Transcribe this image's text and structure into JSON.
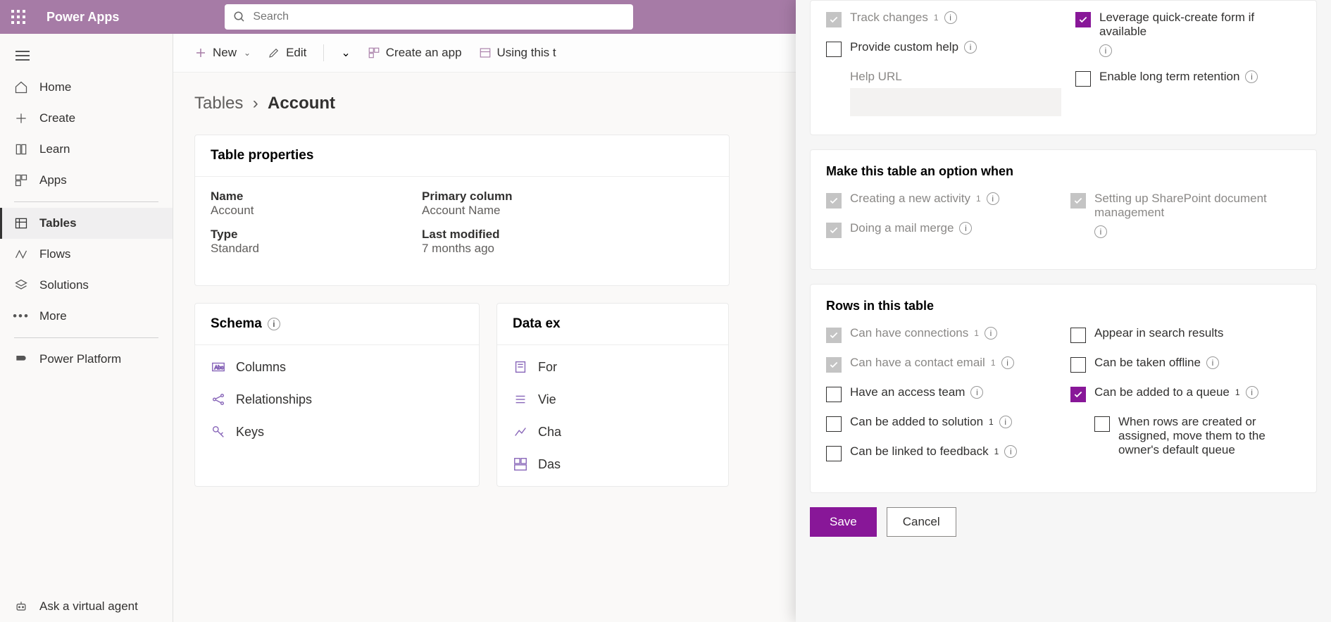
{
  "header": {
    "app_title": "Power Apps",
    "search_placeholder": "Search"
  },
  "nav": {
    "home": "Home",
    "create": "Create",
    "learn": "Learn",
    "apps": "Apps",
    "tables": "Tables",
    "flows": "Flows",
    "solutions": "Solutions",
    "more": "More",
    "power_platform": "Power Platform",
    "ask_agent": "Ask a virtual agent"
  },
  "cmd": {
    "new": "New",
    "edit": "Edit",
    "create_app": "Create an app",
    "using_table": "Using this t"
  },
  "breadcrumb": {
    "root": "Tables",
    "current": "Account"
  },
  "props": {
    "header": "Table properties",
    "name_lbl": "Name",
    "name_val": "Account",
    "primary_lbl": "Primary column",
    "primary_val": "Account Name",
    "type_lbl": "Type",
    "type_val": "Standard",
    "modified_lbl": "Last modified",
    "modified_val": "7 months ago"
  },
  "schema": {
    "header": "Schema",
    "columns": "Columns",
    "relationships": "Relationships",
    "keys": "Keys"
  },
  "dataexp": {
    "header": "Data ex",
    "forms": "For",
    "views": "Vie",
    "charts": "Cha",
    "dashboards": "Das"
  },
  "panel": {
    "sec_top": {
      "track_changes": "Track changes",
      "custom_help": "Provide custom help",
      "help_url_lbl": "Help URL",
      "quick_create": "Leverage quick-create form if available",
      "long_term": "Enable long term retention"
    },
    "sec_option": {
      "title": "Make this table an option when",
      "creating_activity": "Creating a new activity",
      "mail_merge": "Doing a mail merge",
      "sharepoint": "Setting up SharePoint document management"
    },
    "sec_rows": {
      "title": "Rows in this table",
      "connections": "Can have connections",
      "contact_email": "Can have a contact email",
      "access_team": "Have an access team",
      "solution": "Can be added to solution",
      "feedback": "Can be linked to feedback",
      "search": "Appear in search results",
      "offline": "Can be taken offline",
      "queue": "Can be added to a queue",
      "queue_sub": "When rows are created or assigned, move them to the owner's default queue"
    },
    "footer": {
      "save": "Save",
      "cancel": "Cancel"
    }
  }
}
